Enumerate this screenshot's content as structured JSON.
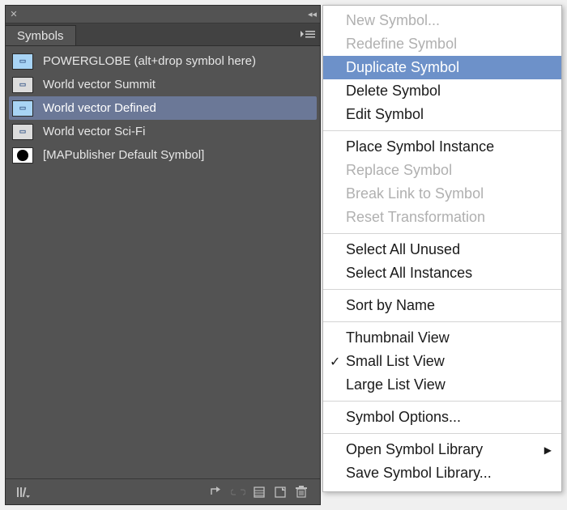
{
  "panel": {
    "title": "Symbols",
    "items": [
      {
        "label": "POWERGLOBE (alt+drop symbol here)",
        "swatch": "blue",
        "selected": false
      },
      {
        "label": "World vector Summit",
        "swatch": "gray",
        "selected": false
      },
      {
        "label": "World vector Defined",
        "swatch": "blue",
        "selected": true
      },
      {
        "label": "World vector Sci-Fi",
        "swatch": "gray",
        "selected": false
      },
      {
        "label": "[MAPublisher Default Symbol]",
        "swatch": "circle",
        "selected": false
      }
    ]
  },
  "menu": {
    "groups": [
      [
        {
          "label": "New Symbol...",
          "state": "disabled"
        },
        {
          "label": "Redefine Symbol",
          "state": "disabled"
        },
        {
          "label": "Duplicate Symbol",
          "state": "hovered"
        },
        {
          "label": "Delete Symbol",
          "state": "normal"
        },
        {
          "label": "Edit Symbol",
          "state": "normal"
        }
      ],
      [
        {
          "label": "Place Symbol Instance",
          "state": "normal"
        },
        {
          "label": "Replace Symbol",
          "state": "disabled"
        },
        {
          "label": "Break Link to Symbol",
          "state": "disabled"
        },
        {
          "label": "Reset Transformation",
          "state": "disabled"
        }
      ],
      [
        {
          "label": "Select All Unused",
          "state": "normal"
        },
        {
          "label": "Select All Instances",
          "state": "normal"
        }
      ],
      [
        {
          "label": "Sort by Name",
          "state": "normal"
        }
      ],
      [
        {
          "label": "Thumbnail View",
          "state": "normal"
        },
        {
          "label": "Small List View",
          "state": "normal",
          "checked": true
        },
        {
          "label": "Large List View",
          "state": "normal"
        }
      ],
      [
        {
          "label": "Symbol Options...",
          "state": "normal"
        }
      ],
      [
        {
          "label": "Open Symbol Library",
          "state": "normal",
          "submenu": true
        },
        {
          "label": "Save Symbol Library...",
          "state": "normal"
        }
      ]
    ]
  }
}
